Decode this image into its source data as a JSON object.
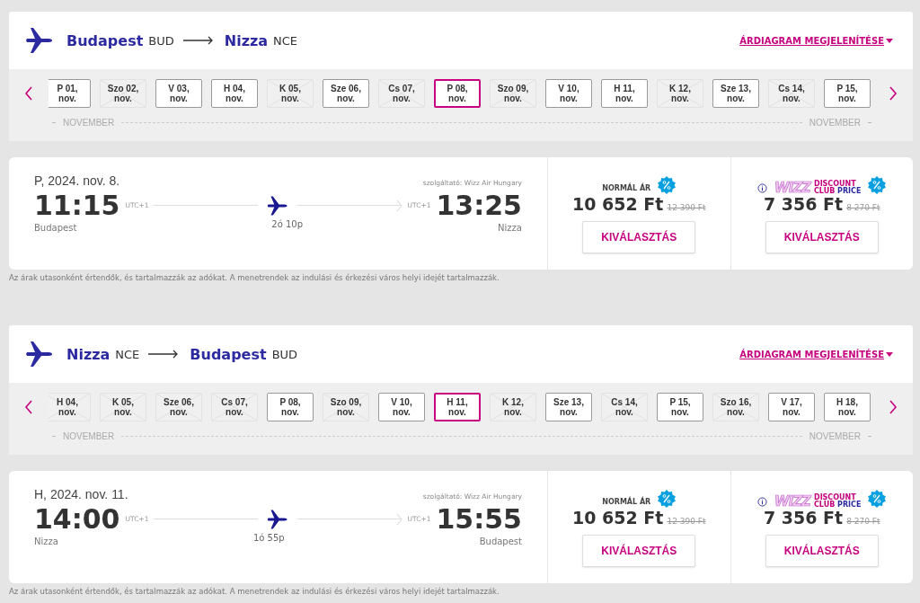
{
  "legs": [
    {
      "from_city": "Budapest",
      "from_code": "BUD",
      "to_city": "Nizza",
      "to_code": "NCE",
      "chart_link": "ÁRDIAGRAM MEGJELENÍTÉSE",
      "dates": [
        {
          "label": "P 01,",
          "month": "nov.",
          "available": true,
          "selected": false
        },
        {
          "label": "Szo 02,",
          "month": "nov.",
          "available": false,
          "selected": false
        },
        {
          "label": "V 03,",
          "month": "nov.",
          "available": true,
          "selected": false
        },
        {
          "label": "H 04,",
          "month": "nov.",
          "available": true,
          "selected": false
        },
        {
          "label": "K 05,",
          "month": "nov.",
          "available": false,
          "selected": false
        },
        {
          "label": "Sze 06,",
          "month": "nov.",
          "available": true,
          "selected": false
        },
        {
          "label": "Cs 07,",
          "month": "nov.",
          "available": false,
          "selected": false
        },
        {
          "label": "P 08,",
          "month": "nov.",
          "available": true,
          "selected": true
        },
        {
          "label": "Szo 09,",
          "month": "nov.",
          "available": false,
          "selected": false
        },
        {
          "label": "V 10,",
          "month": "nov.",
          "available": true,
          "selected": false
        },
        {
          "label": "H 11,",
          "month": "nov.",
          "available": true,
          "selected": false
        },
        {
          "label": "K 12,",
          "month": "nov.",
          "available": false,
          "selected": false
        },
        {
          "label": "Sze 13,",
          "month": "nov.",
          "available": true,
          "selected": false
        },
        {
          "label": "Cs 14,",
          "month": "nov.",
          "available": false,
          "selected": false
        },
        {
          "label": "P 15,",
          "month": "nov.",
          "available": true,
          "selected": false
        }
      ],
      "month_left": "NOVEMBER",
      "month_right": "NOVEMBER",
      "flight": {
        "date": "P, 2024. nov. 8.",
        "operator": "szolgáltató: Wizz Air Hungary",
        "dep_time": "11:15",
        "dep_tz": "UTC+1",
        "arr_time": "13:25",
        "arr_tz": "UTC+1",
        "dep_city": "Budapest",
        "arr_city": "Nizza",
        "duration": "2ó 10p"
      },
      "fares": [
        {
          "kind": "normal",
          "label": "NORMÁL ÁR",
          "price": "10 652 Ft",
          "old_price": "12 390 Ft",
          "button": "KIVÁLASZTÁS"
        },
        {
          "kind": "club",
          "logo": "WIZZ",
          "line1": "DISCOUNT",
          "line2a": "CLUB",
          "line2b": "PRICE",
          "price": "7 356 Ft",
          "old_price": "8 270 Ft",
          "button": "KIVÁLASZTÁS"
        }
      ],
      "note": "Az árak utasonként értendők, és tartalmazzák az adókat. A menetrendek az indulási és érkezési város helyi idejét tartalmazzák."
    },
    {
      "from_city": "Nizza",
      "from_code": "NCE",
      "to_city": "Budapest",
      "to_code": "BUD",
      "chart_link": "ÁRDIAGRAM MEGJELENÍTÉSE",
      "dates": [
        {
          "label": "H 04,",
          "month": "nov.",
          "available": false,
          "selected": false
        },
        {
          "label": "K 05,",
          "month": "nov.",
          "available": false,
          "selected": false
        },
        {
          "label": "Sze 06,",
          "month": "nov.",
          "available": false,
          "selected": false
        },
        {
          "label": "Cs 07,",
          "month": "nov.",
          "available": false,
          "selected": false
        },
        {
          "label": "P 08,",
          "month": "nov.",
          "available": true,
          "selected": false
        },
        {
          "label": "Szo 09,",
          "month": "nov.",
          "available": false,
          "selected": false
        },
        {
          "label": "V 10,",
          "month": "nov.",
          "available": true,
          "selected": false
        },
        {
          "label": "H 11,",
          "month": "nov.",
          "available": true,
          "selected": true
        },
        {
          "label": "K 12,",
          "month": "nov.",
          "available": false,
          "selected": false
        },
        {
          "label": "Sze 13,",
          "month": "nov.",
          "available": true,
          "selected": false
        },
        {
          "label": "Cs 14,",
          "month": "nov.",
          "available": false,
          "selected": false
        },
        {
          "label": "P 15,",
          "month": "nov.",
          "available": true,
          "selected": false
        },
        {
          "label": "Szo 16,",
          "month": "nov.",
          "available": false,
          "selected": false
        },
        {
          "label": "V 17,",
          "month": "nov.",
          "available": true,
          "selected": false
        },
        {
          "label": "H 18,",
          "month": "nov.",
          "available": true,
          "selected": false
        }
      ],
      "month_left": "NOVEMBER",
      "month_right": "NOVEMBER",
      "flight": {
        "date": "H, 2024. nov. 11.",
        "operator": "szolgáltató: Wizz Air Hungary",
        "dep_time": "14:00",
        "dep_tz": "UTC+1",
        "arr_time": "15:55",
        "arr_tz": "UTC+1",
        "dep_city": "Nizza",
        "arr_city": "Budapest",
        "duration": "1ó 55p"
      },
      "fares": [
        {
          "kind": "normal",
          "label": "NORMÁL ÁR",
          "price": "10 652 Ft",
          "old_price": "12 390 Ft",
          "button": "KIVÁLASZTÁS"
        },
        {
          "kind": "club",
          "logo": "WIZZ",
          "line1": "DISCOUNT",
          "line2a": "CLUB",
          "line2b": "PRICE",
          "price": "7 356 Ft",
          "old_price": "8 270 Ft",
          "button": "KIVÁLASZTÁS"
        }
      ],
      "note": "Az árak utasonként értendők, és tartalmazzák az adókat. A menetrendek az indulási és érkezési város helyi idejét tartalmazzák."
    }
  ]
}
